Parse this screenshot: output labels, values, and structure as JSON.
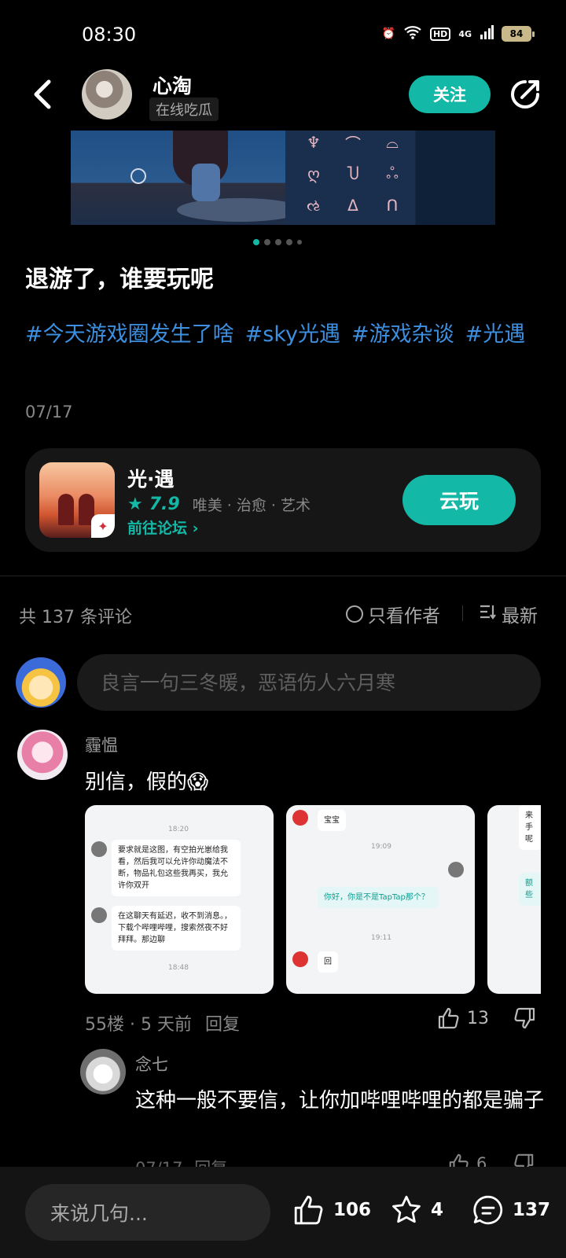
{
  "status_bar": {
    "time": "08:30",
    "network": "4G",
    "hd": "HD",
    "battery": "84"
  },
  "header": {
    "author_name": "心淘",
    "author_tag": "在线吃瓜",
    "follow_label": "关注"
  },
  "post": {
    "title": "退游了，谁要玩呢",
    "tags": [
      "#今天游戏圈发生了啥",
      "#sky光遇",
      "#游戏杂谈",
      "#光遇"
    ],
    "date": "07/17",
    "carousel": {
      "count": 5,
      "active": 0
    }
  },
  "game_card": {
    "name": "光·遇",
    "rating": "7.9",
    "categories": "唯美 · 治愈 · 艺术",
    "forum_link": "前往论坛",
    "play_label": "云玩"
  },
  "comments_header": {
    "count_label": "共 137 条评论",
    "only_author_label": "只看作者",
    "sort_label": "最新"
  },
  "comment_input": {
    "placeholder": "良言一句三冬暖，恶语伤人六月寒"
  },
  "comments": [
    {
      "user": "霾愠",
      "text": "别信，假的😱",
      "meta": "55楼 · 5 天前",
      "reply_label": "回复",
      "likes": "13",
      "screenshots": [
        {
          "time1": "18:20",
          "msg1": "要求就是这图，有空拍光崽给我看，然后我可以允许你动魔法不断，物品礼包这些我再买，我允许你双开",
          "msg2": "在这聊天有延迟，收不到消息。，下载个哔哩哔哩，搜索然夜不好拜拜。那边聊",
          "time2": "18:48"
        },
        {
          "msg1": "宝宝",
          "time1": "19:09",
          "msg2": "你好，你是不是TapTap那个？",
          "time2": "19:11",
          "msg3": "回"
        },
        {
          "msg1": "来手呢",
          "msg2": "额些"
        }
      ]
    }
  ],
  "reply": {
    "user": "念七",
    "text": "这种一般不要信，让你加哔哩哔哩的都是骗子",
    "meta": "07/17",
    "reply_label": "回复",
    "likes": "6"
  },
  "bottom_bar": {
    "input_placeholder": "来说几句...",
    "likes": "106",
    "favorites": "4",
    "comments": "137"
  },
  "colors": {
    "accent": "#14b8a6",
    "tag": "#3d8fe0",
    "background": "#000000"
  }
}
